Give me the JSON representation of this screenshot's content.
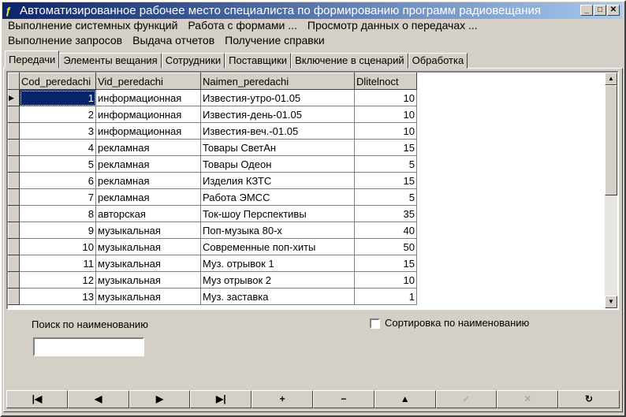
{
  "window": {
    "title": "Автоматизированное рабочее место специалиста по формированию программ радиовещания",
    "min": "_",
    "max": "□",
    "close": "✕"
  },
  "menu": {
    "row1": [
      "Выполнение системных функций",
      "Работа с формами ...",
      "Просмотр данных о передачах ..."
    ],
    "row2": [
      "Выполнение запросов",
      "Выдача отчетов",
      "Получение справки"
    ]
  },
  "tabs": [
    "Передачи",
    "Элементы вещания",
    "Сотрудники",
    "Поставщики",
    "Включение в сценарий",
    "Обработка"
  ],
  "grid": {
    "columns": [
      "Cod_peredachi",
      "Vid_peredachi",
      "Naimen_peredachi",
      "Dlitelnoct"
    ],
    "rows": [
      [
        "1",
        "информационная",
        "Известия-утро-01.05",
        "10"
      ],
      [
        "2",
        "информационная",
        "Известия-день-01.05",
        "10"
      ],
      [
        "3",
        "информационная",
        "Известия-веч.-01.05",
        "10"
      ],
      [
        "4",
        "рекламная",
        "Товары СветАн",
        "15"
      ],
      [
        "5",
        "рекламная",
        "Товары Одеон",
        "5"
      ],
      [
        "6",
        "рекламная",
        "Изделия КЗТС",
        "15"
      ],
      [
        "7",
        "рекламная",
        "Работа ЭМСС",
        "5"
      ],
      [
        "8",
        "авторская",
        "Ток-шоу Перспективы",
        "35"
      ],
      [
        "9",
        "музыкальная",
        "Поп-музыка 80-х",
        "40"
      ],
      [
        "10",
        "музыкальная",
        "Современные поп-хиты",
        "50"
      ],
      [
        "11",
        "музыкальная",
        "Муз. отрывок 1",
        "15"
      ],
      [
        "12",
        "музыкальная",
        "Муз отрывок 2",
        "10"
      ],
      [
        "13",
        "музыкальная",
        "Муз. заставка",
        "1"
      ]
    ]
  },
  "search": {
    "label": "Поиск по наименованию",
    "value": ""
  },
  "sort": {
    "label": "Сортировка по наименованию",
    "checked": false
  },
  "navigator": [
    "|◀",
    "◀",
    "▶",
    "▶|",
    "+",
    "−",
    "▲",
    "✓",
    "✕",
    "↻"
  ]
}
